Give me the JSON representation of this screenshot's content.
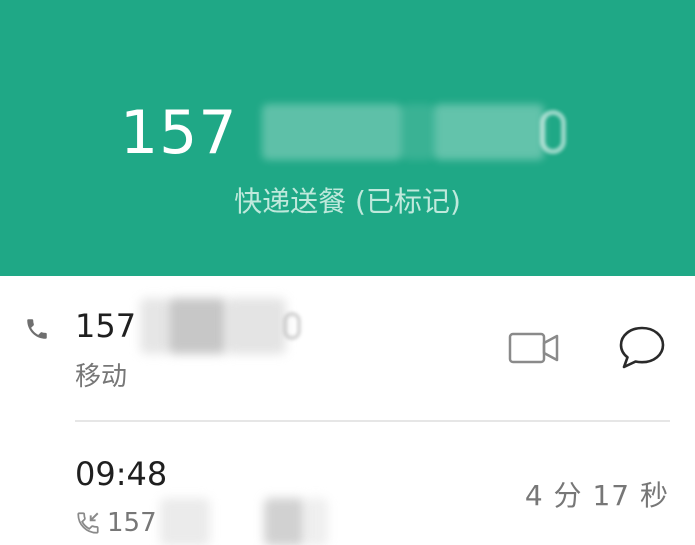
{
  "header": {
    "number_prefix": "157",
    "tag": "快递送餐 (已标记)",
    "background_color": "#1fa886"
  },
  "contact_row": {
    "icon": "phone-icon",
    "number_prefix": "157",
    "carrier": "移动",
    "actions": [
      {
        "icon": "video-call-icon"
      },
      {
        "icon": "message-icon"
      }
    ]
  },
  "call_log": {
    "time": "09:48",
    "direction_icon": "incoming-call-icon",
    "number_prefix": "157",
    "duration": "4 分 17 秒"
  }
}
